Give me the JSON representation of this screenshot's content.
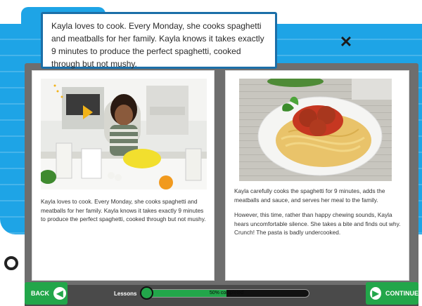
{
  "callout": {
    "text": "Kayla loves to cook. Every Monday, she cooks spaghetti and meatballs for her family. Kayla knows it takes exactly 9 minutes to produce the perfect spaghetti, cooked through but not mushy."
  },
  "book": {
    "left_page": {
      "image": "girl-cooking-photo",
      "text": "Kayla loves to cook. Every Monday, she cooks spaghetti and meatballs for her family. Kayla knows it takes exactly 9 minutes to produce the perfect spaghetti, cooked through but not mushy."
    },
    "right_page": {
      "image": "spaghetti-meatballs-photo",
      "paragraphs": [
        "Kayla carefully cooks the spaghetti for 9 minutes, adds the meatballs and sauce, and serves her meal to the family.",
        "However, this time, rather than happy chewing sounds, Kayla hears uncomfortable silence. She takes a bite and finds out why. Crunch! The pasta is badly undercooked."
      ]
    }
  },
  "nav": {
    "back_label": "BACK",
    "continue_label": "CONTINUE",
    "lessons_label": "Lessons",
    "progress_percent": 50,
    "progress_text": "50% completed"
  },
  "icons": {
    "close": "close-icon",
    "back_arrow": "left-arrow-icon",
    "continue_arrow": "right-arrow-icon"
  },
  "colors": {
    "background_blue": "#1ea4e6",
    "callout_border": "#1b6fa8",
    "button_green": "#22a64a",
    "bar_dark": "#4a4a4a"
  }
}
